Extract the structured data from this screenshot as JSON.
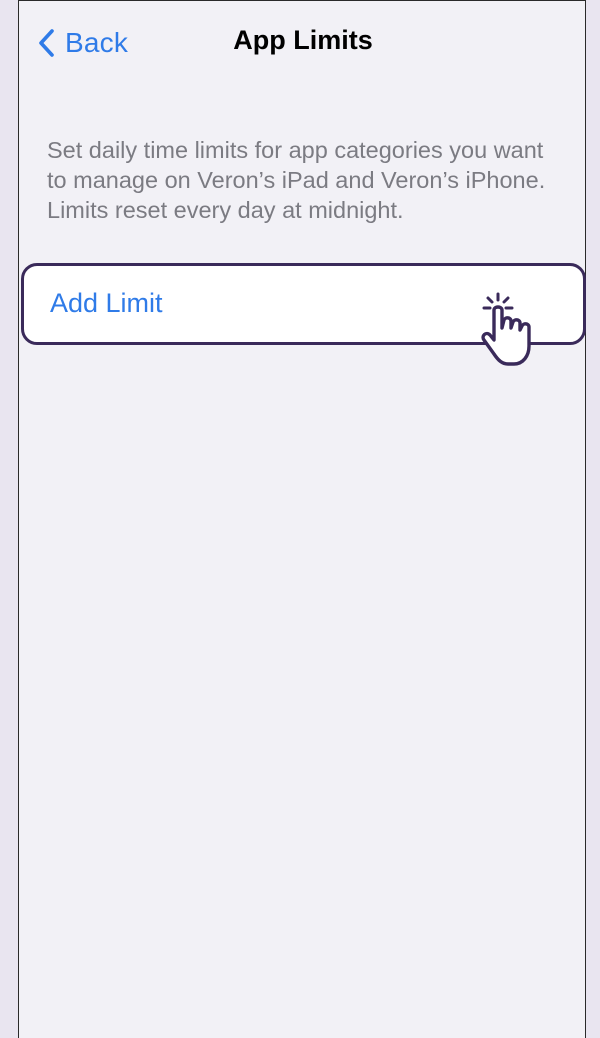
{
  "nav": {
    "back_label": "Back",
    "title": "App Limits"
  },
  "description": "Set daily time limits for app categories you want to manage on Veron’s iPad and Veron’s iPhone. Limits reset every day at midnight.",
  "add_limit": {
    "label": "Add Limit"
  },
  "colors": {
    "accent": "#2f7be8",
    "highlight_border": "#3a2a5a",
    "background": "#f2f1f6",
    "outer_background": "#e9e5f0"
  },
  "icons": {
    "back": "chevron-left-icon",
    "tap": "tap-hand-icon"
  }
}
